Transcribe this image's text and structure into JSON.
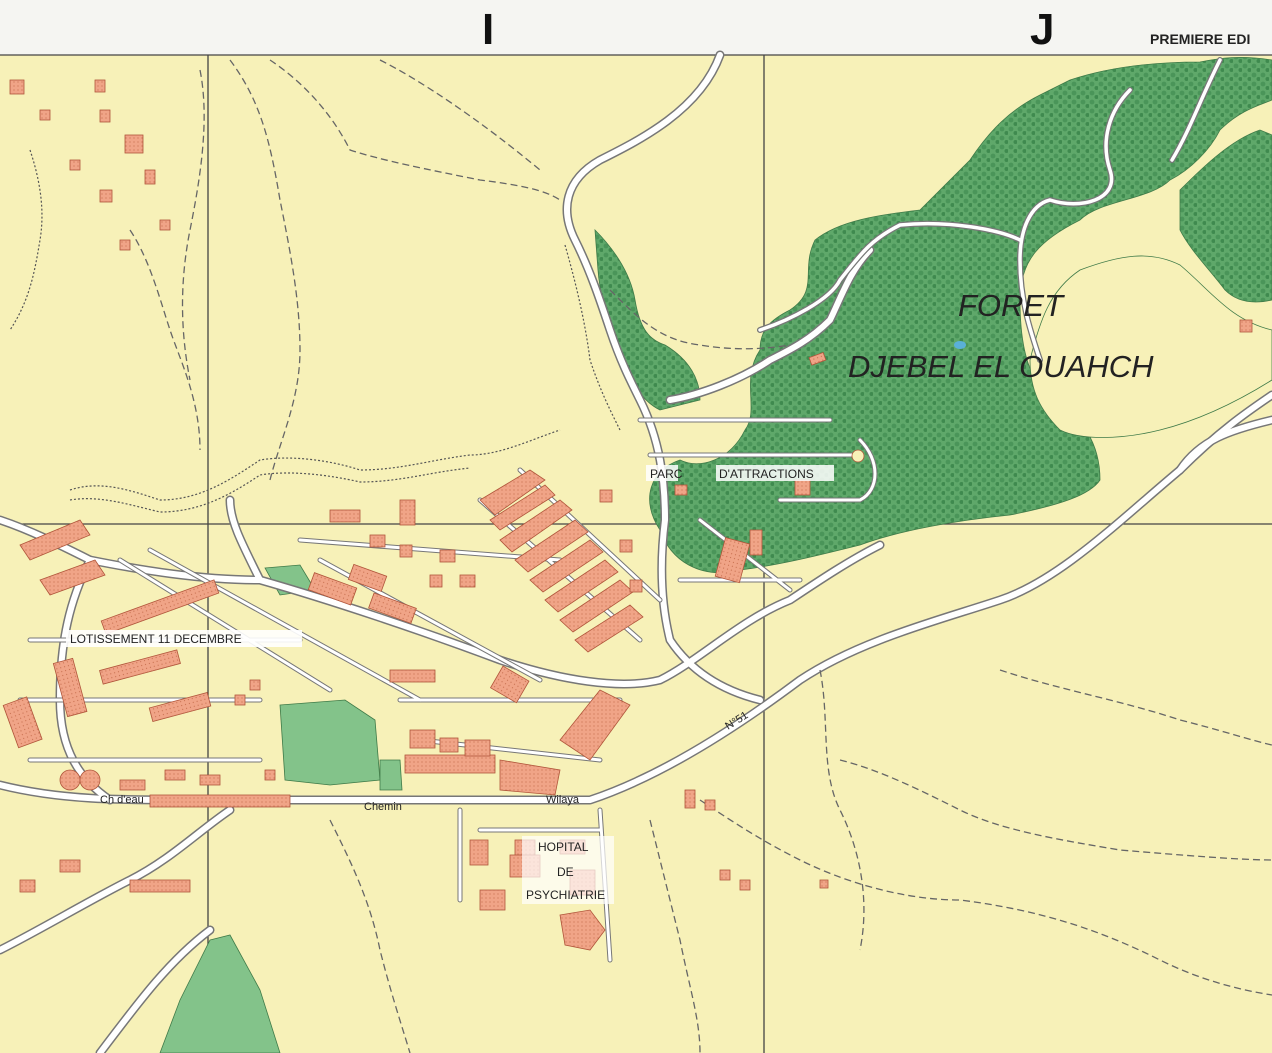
{
  "header": {
    "grid_letters": [
      "I",
      "J"
    ],
    "edition": "PREMIERE EDI"
  },
  "labels": {
    "forest_line1": "FORET",
    "forest_line2": "DJEBEL EL OUAHCH",
    "park_a": "PARC",
    "park_b": "D'ATTRACTIONS",
    "lotissement": "LOTISSEMENT 11 DECEMBRE",
    "hospital_1": "HOPITAL",
    "hospital_2": "DE",
    "hospital_3": "PSYCHIATRIE",
    "chemin": "Chemin",
    "wilaya": "Wilaya",
    "route": "N°51",
    "water_tower": "Ch d'eau"
  },
  "colors": {
    "paper": "#f7f1b8",
    "forest": "#5fa86a",
    "forest_dark": "#3f8a4f",
    "building": "#f0a487",
    "building_edge": "#b0553a",
    "road_fill": "#ffffff",
    "road_edge": "#777777",
    "grid": "#444444",
    "park_green": "#83c38a"
  }
}
